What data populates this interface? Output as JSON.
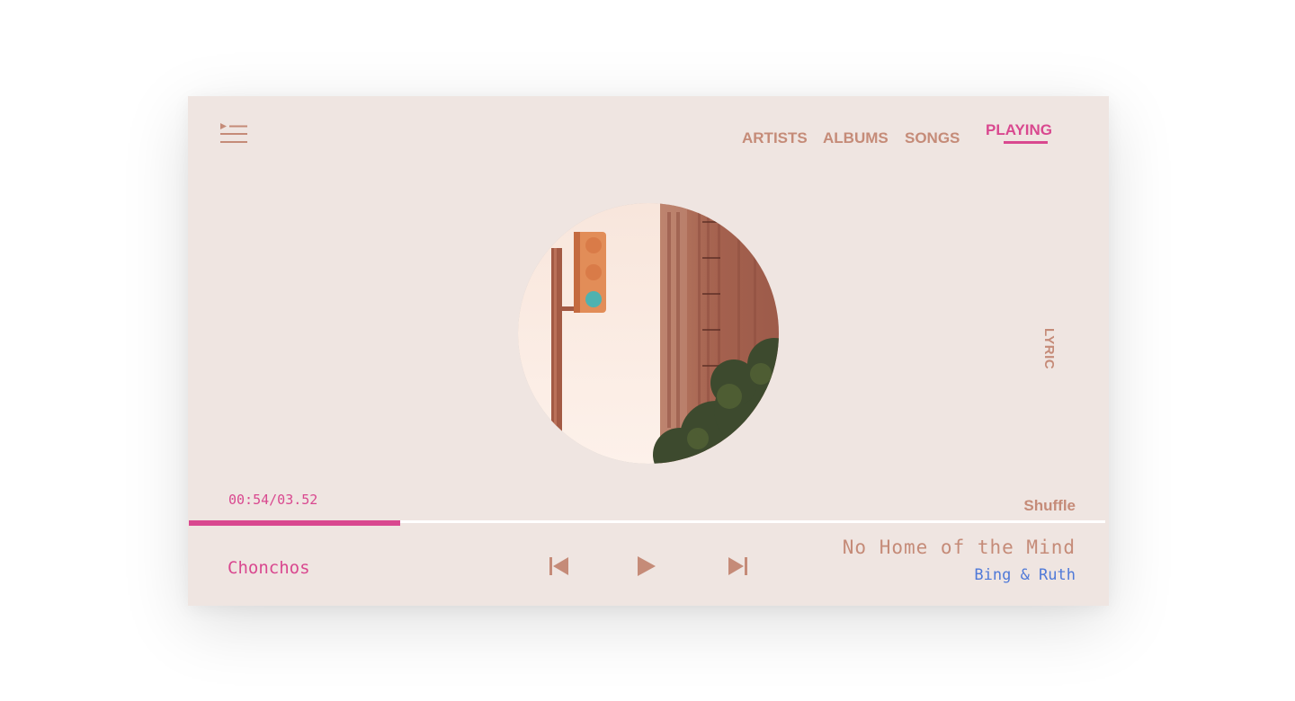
{
  "nav": {
    "items": [
      {
        "label": "ARTISTS",
        "active": false
      },
      {
        "label": "ALBUMS",
        "active": false
      },
      {
        "label": "SONGS",
        "active": false
      },
      {
        "label": "PLAYING",
        "active": true
      }
    ]
  },
  "side": {
    "lyric_label": "LYRIC"
  },
  "playback": {
    "time_display": "00:54/03.52",
    "progress": 0.231,
    "shuffle_label": "Shuffle"
  },
  "footer": {
    "playlist_name": "Chonchos",
    "track_title": "No Home of the Mind",
    "track_artist": "Bing & Ruth"
  },
  "icons": {
    "menu": "playlist-menu-icon",
    "previous": "skip-previous-icon",
    "play": "play-icon",
    "next": "skip-next-icon"
  },
  "colors": {
    "background": "#efe5e1",
    "accent": "#d9488f",
    "muted": "#c58b78",
    "link": "#4f79d8"
  }
}
